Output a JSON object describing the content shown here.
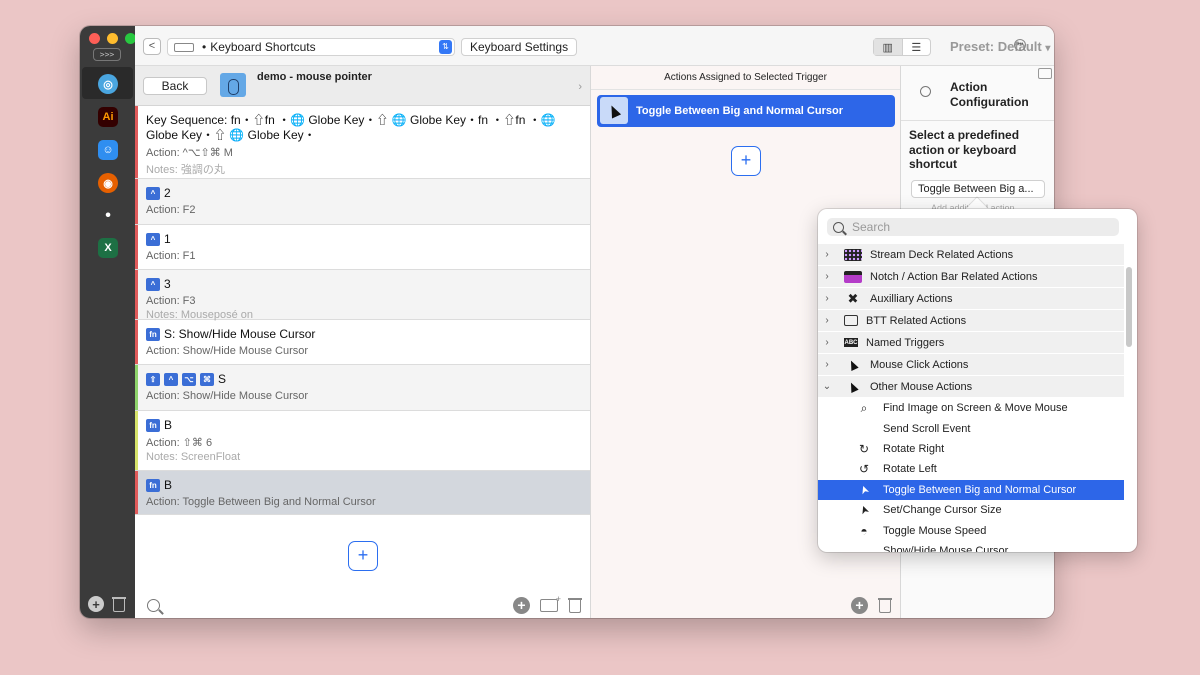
{
  "sidebar": {
    "expand_label": ">>>",
    "apps": [
      {
        "name": "globe-app",
        "color": "#4aa6e0",
        "glyph": "◎"
      },
      {
        "name": "illustrator-app",
        "color": "#330000",
        "glyph": "Ai"
      },
      {
        "name": "finder-app",
        "color": "#2f8ef0",
        "glyph": "☺"
      },
      {
        "name": "firefox-app",
        "color": "#e66000",
        "glyph": "◉"
      },
      {
        "name": "dot-app",
        "color": "#ffffff",
        "glyph": "•"
      },
      {
        "name": "excel-app",
        "color": "#1d7044",
        "glyph": "X"
      }
    ]
  },
  "toolbar": {
    "back_glyph": "<",
    "trigger_type": "Keyboard Shortcuts",
    "trigger_settings_label": "Keyboard Settings",
    "preset_label": "Preset: Default",
    "preset_chevron": "▾"
  },
  "trigger_panel": {
    "back_label": "Back",
    "app_title": "demo - mouse pointer",
    "triggers": [
      {
        "shortcut": "Key Sequence: fn・⇧fn ・🌐 Globe Key・⇧ 🌐 Globe Key・fn ・⇧fn ・🌐 Globe Key・⇧ 🌐 Globe Key・",
        "action": "Action: ^⌥⇧⌘ M",
        "notes": "Notes: 強調の丸",
        "color": "#e05a5a"
      },
      {
        "badge": "^",
        "shortcut": "2",
        "action": "Action:  F2",
        "notes": "",
        "color": "#e05a5a"
      },
      {
        "badge": "^",
        "shortcut": "1",
        "action": "Action:  F1",
        "notes": "",
        "color": "#e05a5a"
      },
      {
        "badge": "^",
        "shortcut": "3",
        "action": "Action:  F3",
        "notes": "Notes: Mouseposé on",
        "color": "#e05a5a"
      },
      {
        "badge": "fn",
        "shortcut": "S: Show/Hide Mouse Cursor",
        "action": "Action: Show/Hide Mouse Cursor",
        "notes": "",
        "color": "#e05a5a"
      },
      {
        "badges": [
          "⇧",
          "^",
          "⌥",
          "⌘"
        ],
        "shortcut": "S",
        "action": "Action: Show/Hide Mouse Cursor",
        "notes": "",
        "color": "#8ed36b"
      },
      {
        "badge": "fn",
        "shortcut": "B",
        "action": "Action: ⇧⌘ 6",
        "notes": "Notes: ScreenFloat",
        "color": "#d6e36a"
      },
      {
        "badge": "fn",
        "shortcut": "B",
        "action": "Action: Toggle Between Big and Normal Cursor",
        "notes": "",
        "color": "#e05a5a"
      }
    ],
    "add_label": "+"
  },
  "actions_panel": {
    "title": "Actions Assigned to Selected Trigger",
    "assigned_action": "Toggle Between Big and Normal Cursor",
    "add_label": "+"
  },
  "config_panel": {
    "title": "Action Configuration",
    "select_prompt": "Select a predefined action or keyboard shortcut",
    "selected_action": "Toggle Between Big a...",
    "add_additional": "Add additional action"
  },
  "popover": {
    "search_placeholder": "Search",
    "categories": [
      {
        "label": "Stream Deck Related Actions",
        "icon": "stream-deck-icon",
        "expanded": false
      },
      {
        "label": "Notch / Action Bar Related Actions",
        "icon": "notch-icon",
        "expanded": false
      },
      {
        "label": "Auxilliary Actions",
        "icon": "tools-icon",
        "expanded": false
      },
      {
        "label": "BTT Related Actions",
        "icon": "btt-icon",
        "expanded": false
      },
      {
        "label": "Named Triggers",
        "icon": "abc-icon",
        "expanded": false
      },
      {
        "label": "Mouse Click Actions",
        "icon": "cursor-icon",
        "expanded": false
      },
      {
        "label": "Other Mouse Actions",
        "icon": "cursor-icon",
        "expanded": true
      }
    ],
    "items": [
      {
        "label": "Find Image on Screen & Move Mouse",
        "icon": "magnifier-icon",
        "selected": false
      },
      {
        "label": "Send Scroll Event",
        "icon": "",
        "selected": false
      },
      {
        "label": "Rotate Right",
        "icon": "rotate-right-icon",
        "selected": false
      },
      {
        "label": "Rotate Left",
        "icon": "rotate-left-icon",
        "selected": false
      },
      {
        "label": "Toggle Between Big and Normal Cursor",
        "icon": "big-cursor-icon",
        "selected": true
      },
      {
        "label": "Set/Change Cursor Size",
        "icon": "big-cursor-icon",
        "selected": false
      },
      {
        "label": "Toggle Mouse Speed",
        "icon": "speedometer-icon",
        "selected": false
      },
      {
        "label": "Show/Hide Mouse Cursor",
        "icon": "",
        "selected": false
      }
    ]
  }
}
